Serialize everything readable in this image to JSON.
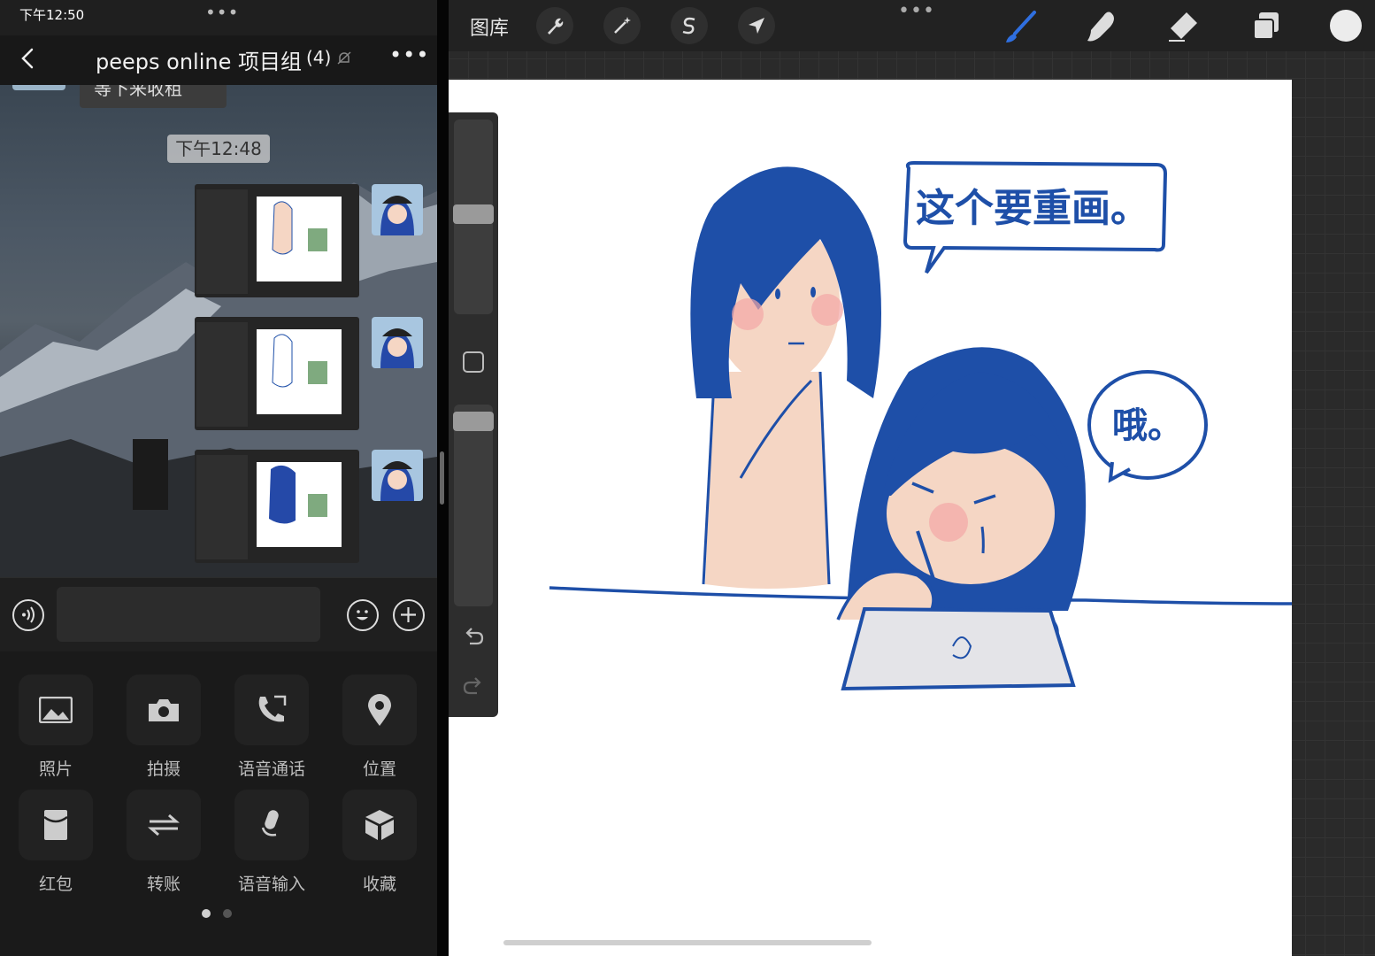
{
  "status_bar": {
    "time": "下午12:50",
    "multitask_dots": "•••"
  },
  "chat": {
    "title": "peeps online 项目组",
    "member_count": "(4)",
    "more": "•••",
    "previous_message_fragment": "等下来收租",
    "timestamp": "下午12:48",
    "image_messages": 3
  },
  "input": {
    "placeholder": ""
  },
  "panel": {
    "items": [
      {
        "label": "照片",
        "icon": "photo-icon"
      },
      {
        "label": "拍摄",
        "icon": "camera-icon"
      },
      {
        "label": "语音通话",
        "icon": "voice-call-icon"
      },
      {
        "label": "位置",
        "icon": "location-icon"
      },
      {
        "label": "红包",
        "icon": "red-packet-icon"
      },
      {
        "label": "转账",
        "icon": "transfer-icon"
      },
      {
        "label": "语音输入",
        "icon": "microphone-icon"
      },
      {
        "label": "收藏",
        "icon": "favorites-icon"
      }
    ],
    "page": 1,
    "page_count": 2
  },
  "drawing_app": {
    "gallery_label": "图库",
    "menu_dots": "•••",
    "active_tool": "brush",
    "brush_color": "#1e4fa8",
    "current_color": "#ececec",
    "canvas_text": {
      "speech_bubble_1": "这个要重画。",
      "speech_bubble_2": "哦。"
    }
  },
  "colors": {
    "accent_blue": "#2f6fe0",
    "ink": "#1e4fa8",
    "skin": "#f5d6c4",
    "blush": "#f4a7a7"
  }
}
